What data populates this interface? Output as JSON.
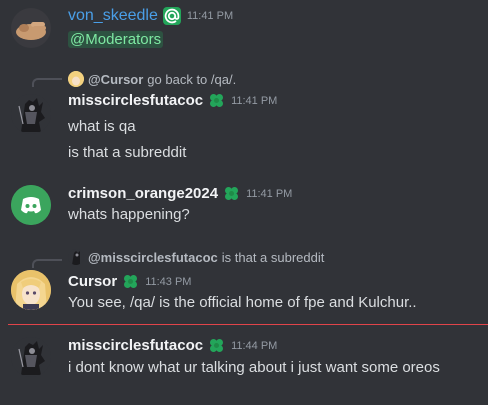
{
  "messages": [
    {
      "author": "von_skeedle",
      "time": "11:41 PM",
      "lines": [
        "@Moderators"
      ]
    },
    {
      "reply": {
        "author": "@Cursor",
        "text": "go back to /qa/."
      },
      "author": "misscirclesfutacoc",
      "time": "11:41 PM",
      "lines": [
        "what is qa",
        "is that a subreddit"
      ]
    },
    {
      "author": "crimson_orange2024",
      "time": "11:41 PM",
      "lines": [
        "whats happening?"
      ]
    },
    {
      "reply": {
        "author": "@misscirclesfutacoc",
        "text": "is that a subreddit"
      },
      "author": "Cursor",
      "time": "11:43 PM",
      "lines": [
        "You see, /qa/ is the official home of fpe and Kulchur.."
      ]
    },
    {
      "author": "misscirclesfutacoc",
      "time": "11:44 PM",
      "lines": [
        "i dont know what ur talking about i just want some oreos"
      ]
    }
  ],
  "colors": {
    "background": "#313338",
    "username_blue": "#4a9fe8",
    "badge_green": "#23a55a",
    "discord_blurple": "#5865f2",
    "new_divider": "#e0444a",
    "mention_green_text": "#7ee8a2"
  },
  "icons": [
    "at-badge-icon",
    "clover-badge-icon",
    "discord-logo-icon"
  ]
}
